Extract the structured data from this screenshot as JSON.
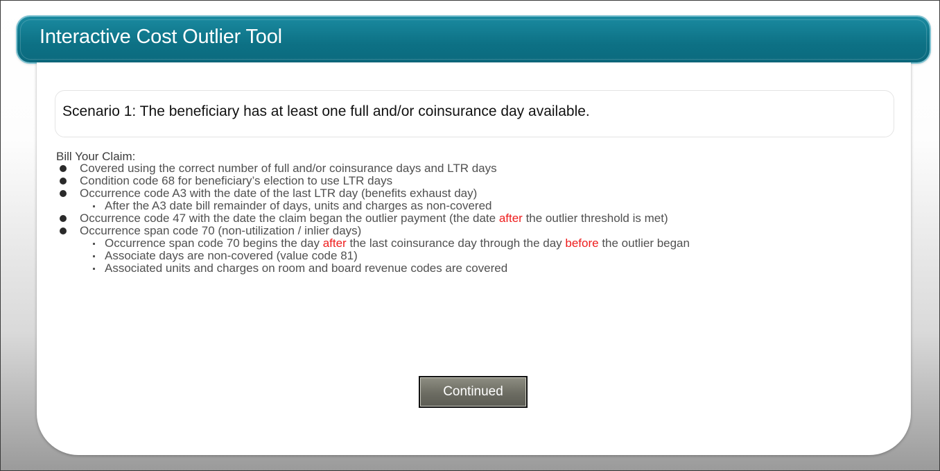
{
  "header": {
    "title": "Interactive Cost Outlier Tool"
  },
  "scenario": {
    "text": "Scenario 1: The beneficiary has at least one full and/or coinsurance day available."
  },
  "bill": {
    "heading": "Bill Your Claim:",
    "item1": "Covered using the correct number of full and/or coinsurance days and LTR days",
    "item2": "Condition code 68 for beneficiary’s election to use LTR days",
    "item3": "Occurrence code A3 with the date of the last LTR day (benefits exhaust day)",
    "item3_sub1": "After the A3 date bill remainder of days, units and charges as non-covered",
    "item4_a": "Occurrence code 47 with the date the claim began the outlier payment (the date ",
    "item4_hl": "after",
    "item4_b": " the outlier threshold is met)",
    "item5": "Occurrence span code 70 (non-utilization / inlier days)",
    "item5_sub1_a": "Occurrence span code 70 begins the day ",
    "item5_sub1_hl1": "after",
    "item5_sub1_b": " the last coinsurance day through the day ",
    "item5_sub1_hl2": "before",
    "item5_sub1_c": " the outlier began",
    "item5_sub2": "Associate days are non-covered (value code 81)",
    "item5_sub3": "Associated units and charges on room and board revenue codes are covered"
  },
  "continue_label": "Continued",
  "colors": {
    "header": "#0d7185",
    "highlight": "#ee1c1c"
  }
}
